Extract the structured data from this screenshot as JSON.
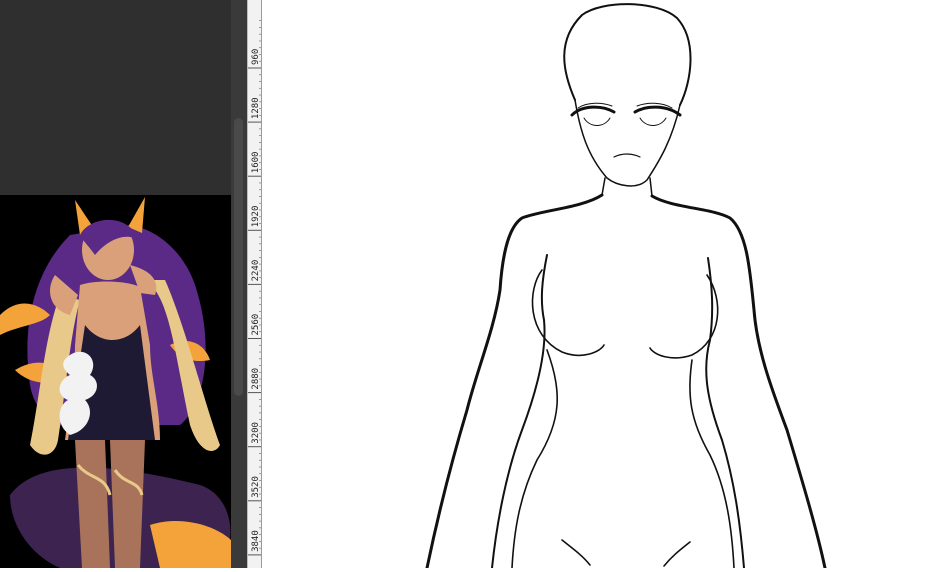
{
  "panel": {
    "reference_image": "character-reference-illustration",
    "colors": {
      "panel_bg": "#2f2f2f",
      "reference_bg": "#000000",
      "hair": "#5b2a86",
      "hair_tip": "#f4a23a",
      "skin": "#d9a07a",
      "dress": "#1f1a33",
      "ribbon": "#f2f2f2"
    }
  },
  "ruler": {
    "orientation": "vertical",
    "labels": [
      "960",
      "1280",
      "1600",
      "1920",
      "2240",
      "2560",
      "2880",
      "3200",
      "3520",
      "3840"
    ]
  },
  "canvas": {
    "content": "line-art-figure-sketch",
    "colors": {
      "background": "#ffffff",
      "line": "#111111"
    }
  }
}
